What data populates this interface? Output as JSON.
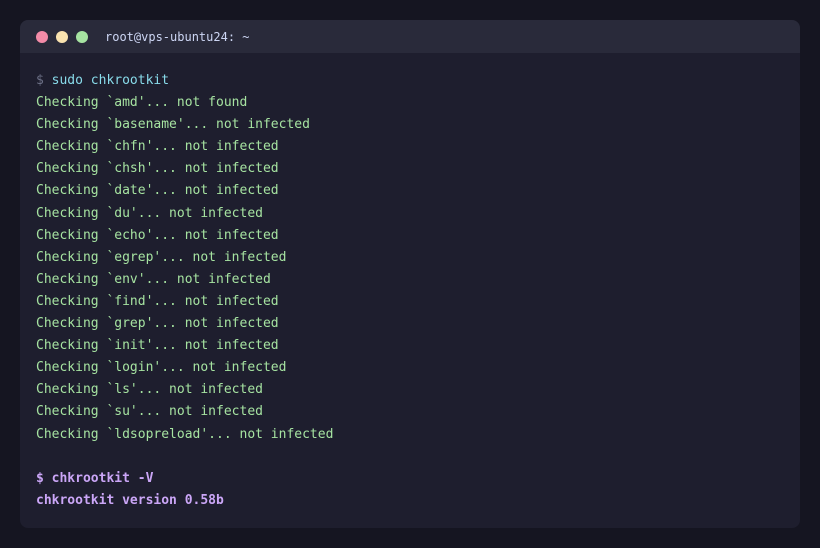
{
  "window": {
    "title": "root@vps-ubuntu24: ~",
    "dots": [
      {
        "name": "close",
        "color": "#f38ba8"
      },
      {
        "name": "minimize",
        "color": "#f9e2af"
      },
      {
        "name": "maximize",
        "color": "#a6e3a1"
      }
    ]
  },
  "terminal": {
    "prompt_symbol": "$",
    "command1": "sudo chkrootkit",
    "output1": [
      "Checking `amd'... not found",
      "Checking `basename'... not infected",
      "Checking `chfn'... not infected",
      "Checking `chsh'... not infected",
      "Checking `date'... not infected",
      "Checking `du'... not infected",
      "Checking `echo'... not infected",
      "Checking `egrep'... not infected",
      "Checking `env'... not infected",
      "Checking `find'... not infected",
      "Checking `grep'... not infected",
      "Checking `init'... not infected",
      "Checking `login'... not infected",
      "Checking `ls'... not infected",
      "Checking `su'... not infected",
      "Checking `ldsopreload'... not infected"
    ],
    "command2_line": "$ chkrootkit -V",
    "output2": "chkrootkit version 0.58b"
  }
}
